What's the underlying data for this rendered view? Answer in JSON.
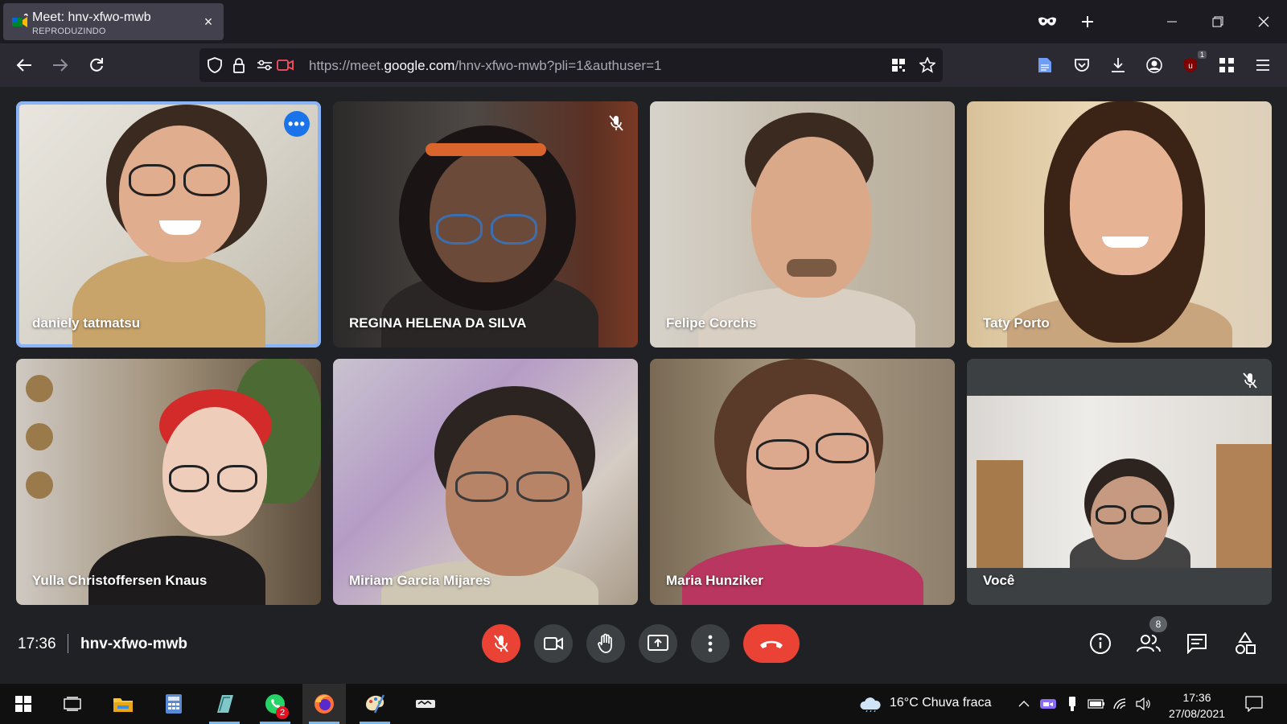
{
  "browser": {
    "tab": {
      "title": "Meet: hnv-xfwo-mwb",
      "subtitle": "REPRODUZINDO",
      "close_glyph": "×"
    },
    "url": {
      "prefix": "https://meet.",
      "domain": "google.com",
      "path": "/hnv-xfwo-mwb?pli=1&authuser=1"
    },
    "toolbar_badge": "1",
    "icons": [
      "private-mask-icon",
      "new-tab-icon",
      "minimize-icon",
      "restore-icon",
      "close-window-icon",
      "back-icon",
      "forward-icon",
      "reload-icon",
      "shield-icon",
      "lock-icon",
      "permissions-icon",
      "camera-blocked-icon",
      "qr-code-icon",
      "bookmark-star-icon",
      "reader-icon",
      "pocket-icon",
      "download-icon",
      "account-icon",
      "ublock-icon",
      "extensions-icon",
      "menu-icon"
    ]
  },
  "participants": [
    {
      "name": "daniely tatmatsu",
      "active": true,
      "muted": false
    },
    {
      "name": "REGINA HELENA DA SILVA",
      "active": false,
      "muted": true
    },
    {
      "name": "Felipe Corchs",
      "active": false,
      "muted": false
    },
    {
      "name": "Taty Porto",
      "active": false,
      "muted": false
    },
    {
      "name": "Yulla Christoffersen Knaus",
      "active": false,
      "muted": false
    },
    {
      "name": "Miriam Garcia Mijares",
      "active": false,
      "muted": false
    },
    {
      "name": "Maria Hunziker",
      "active": false,
      "muted": false
    },
    {
      "name": "Você",
      "active": false,
      "muted": true
    }
  ],
  "meeting": {
    "time": "17:36",
    "code": "hnv-xfwo-mwb",
    "people_count": "8",
    "controls": [
      "mic-off-icon",
      "camera-icon",
      "raise-hand-icon",
      "present-icon",
      "more-options-icon",
      "hang-up-icon",
      "info-icon",
      "people-icon",
      "chat-icon",
      "activities-icon"
    ]
  },
  "taskbar": {
    "whatsapp_badge": "2",
    "weather": "16°C  Chuva fraca",
    "time": "17:36",
    "date": "27/08/2021"
  },
  "colors": {
    "accent_blue": "#8ab4f8",
    "meet_red": "#ea4335",
    "meet_bg": "#202124"
  }
}
